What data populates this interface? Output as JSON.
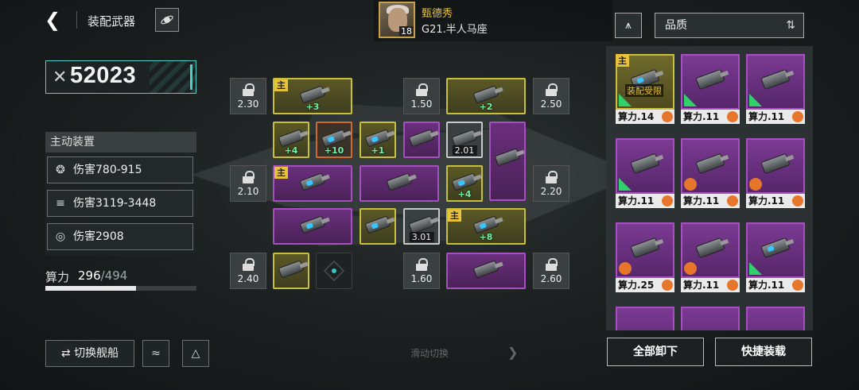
{
  "header": {
    "title": "装配武器",
    "captain_name": "甄德秀",
    "captain_level": "18",
    "ship_name": "G21.半人马座"
  },
  "left": {
    "combat_power": "52023",
    "active_title": "主动装置",
    "stats": [
      {
        "label": "伤害780-915",
        "icon": "cluster-missile-icon"
      },
      {
        "label": "伤害3119-3448",
        "icon": "claw-strike-icon"
      },
      {
        "label": "伤害2908",
        "icon": "target-burst-icon"
      }
    ],
    "capacity_label": "算力",
    "capacity_used": "296",
    "capacity_max": "/494",
    "capacity_fraction": 0.599,
    "switch_ship": "切换舰船"
  },
  "grid": {
    "locks": [
      "2.30",
      "1.50",
      "2.50",
      "2.10",
      "2.20",
      "2.40",
      "1.60",
      "2.60"
    ],
    "main_tag": "主",
    "plus": [
      "+3",
      "+2",
      "+4",
      "+10",
      "+1",
      "+4",
      "+8"
    ],
    "slot_values": [
      "2.01",
      "3.01"
    ]
  },
  "swipe_label": "滑动切换",
  "right": {
    "quality_label": "品质",
    "limit_text": "装配受限",
    "cards": [
      {
        "label": "算力.14",
        "rarity": "gold",
        "main": true,
        "badge": "green",
        "limited": true
      },
      {
        "label": "算力.11",
        "rarity": "purple",
        "badge": "green"
      },
      {
        "label": "算力.11",
        "rarity": "purple",
        "badge": "green"
      },
      {
        "label": "算力.11",
        "rarity": "purple",
        "badge": "green"
      },
      {
        "label": "算力.11",
        "rarity": "purple",
        "badge": "orange"
      },
      {
        "label": "算力.11",
        "rarity": "purple",
        "badge": "orange"
      },
      {
        "label": "算力.25",
        "rarity": "purple",
        "badge": "orange"
      },
      {
        "label": "算力.11",
        "rarity": "purple",
        "badge": "orange"
      },
      {
        "label": "算力.11",
        "rarity": "purple",
        "badge": "green"
      }
    ],
    "unload_all": "全部卸下",
    "quick_load": "快捷装载"
  },
  "colors": {
    "gold": "#c8bf3a",
    "purple": "#a64fc0",
    "accent": "#4ed0c8",
    "plus_green": "#6ef2a6"
  }
}
